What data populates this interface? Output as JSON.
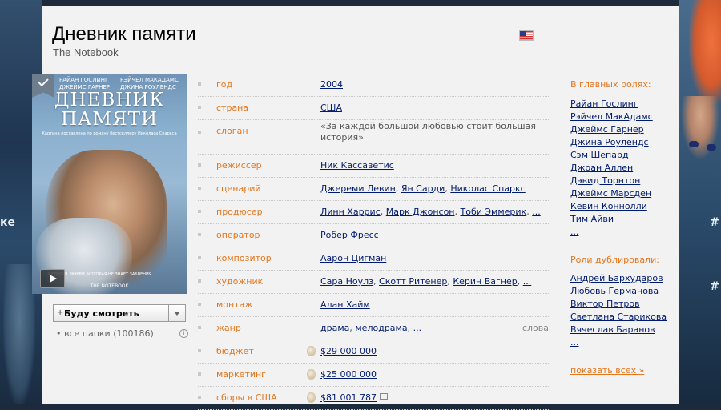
{
  "title": "Дневник памяти",
  "subtitle": "The Notebook",
  "poster": {
    "actors_row1": [
      "РАЙАН ГОСЛИНГ",
      "РЭЙЧЕЛ МАКАДАМС"
    ],
    "actors_row2": [
      "ДЖЕЙМС ГАРНЕР",
      "ДЖИНА РОУЛЕНДС"
    ],
    "title_line1": "ДНЕВНИК",
    "title_line2": "ПАМЯТИ",
    "tagline": "Картина поставлена по роману бестселлеру Николаса Спаркса",
    "quote": "ИСТОРИЯ ЛЮБВИ, КОТОРАЯ НЕ ЗНАЕТ ЗАБВЕНИЯ",
    "bottom": "THE NOTEBOOK"
  },
  "watch_button": {
    "plus": "+",
    "label": "Буду смотреть"
  },
  "folders_text": "• все папки (100186)",
  "info_icon": "i",
  "info_rows": [
    {
      "key": "год",
      "links": [
        "2004"
      ]
    },
    {
      "key": "страна",
      "links": [
        "США"
      ]
    },
    {
      "key": "слоган",
      "text": "«За каждой большой любовью стоит большая история»"
    },
    {
      "key": "режиссер",
      "links": [
        "Ник Кассаветис"
      ]
    },
    {
      "key": "сценарий",
      "links": [
        "Джереми Левин",
        "Ян Сарди",
        "Николас Спаркс"
      ]
    },
    {
      "key": "продюсер",
      "links": [
        "Линн Харрис",
        "Марк Джонсон",
        "Тоби Эммерик",
        "..."
      ]
    },
    {
      "key": "оператор",
      "links": [
        "Робер Фресс"
      ]
    },
    {
      "key": "композитор",
      "links": [
        "Аарон Цигман"
      ]
    },
    {
      "key": "художник",
      "links": [
        "Сара Ноулз",
        "Скотт Ритенер",
        "Керин Вагнер",
        "..."
      ]
    },
    {
      "key": "монтаж",
      "links": [
        "Алан Хайм"
      ]
    },
    {
      "key": "жанр",
      "links": [
        "драма",
        "мелодрама",
        "..."
      ],
      "extra": "слова"
    },
    {
      "key": "бюджет",
      "links": [
        "$29 000 000"
      ],
      "coin": true
    },
    {
      "key": "маркетинг",
      "links": [
        "$25 000 000"
      ],
      "coin": true
    },
    {
      "key": "сборы в США",
      "links": [
        "$81 001 787"
      ],
      "coin": true,
      "mail": true
    }
  ],
  "cast": {
    "main_heading": "В главных ролях:",
    "main": [
      "Райан Гослинг",
      "Рэйчел МакАдамс",
      "Джеймс Гарнер",
      "Джина Роулендс",
      "Сэм Шепард",
      "Джоан Аллен",
      "Дэвид Торнтон",
      "Джеймс Марсден",
      "Кевин Коннолли",
      "Тим Айви",
      "..."
    ],
    "dub_heading": "Роли дублировали:",
    "dub": [
      "Андрей Бархударов",
      "Любовь Германова",
      "Виктор Петров",
      "Светлана Старикова",
      "Вячеслав Баранов",
      "..."
    ],
    "show_all": "показать всех »"
  },
  "background": {
    "left_arrow": "ке",
    "right_arrow": "#",
    "right_arrow2": "#"
  },
  "colors": {
    "label": "#e5761e",
    "link": "#001a6e",
    "panel": "#f2f2f2"
  }
}
